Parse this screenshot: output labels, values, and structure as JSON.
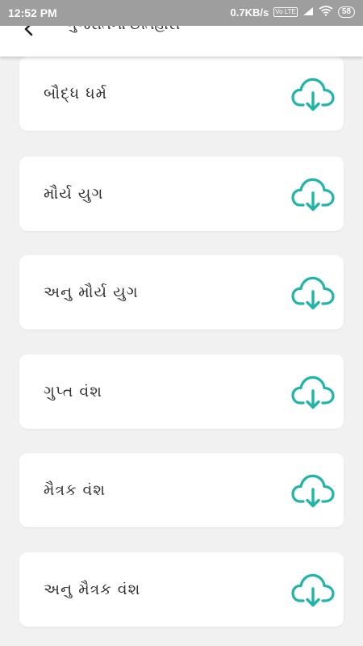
{
  "status_bar": {
    "time": "12:52 PM",
    "net_speed": "0.7KB/s",
    "volte": "Vo LTE",
    "battery": "58"
  },
  "app_bar": {
    "title": "ગુજરાતનો ઈતિહાસ",
    "back_icon": "back-chevron-icon"
  },
  "accent_color": "#1fb5a7",
  "items": [
    {
      "label": "બૌદ્ધ ધર્મ",
      "icon": "cloud-download-icon"
    },
    {
      "label": "મૌર્ય યુગ",
      "icon": "cloud-download-icon"
    },
    {
      "label": "અનુ મૌર્ય યુગ",
      "icon": "cloud-download-icon"
    },
    {
      "label": "ગુપ્ત વંશ",
      "icon": "cloud-download-icon"
    },
    {
      "label": "મૈત્રક વંશ",
      "icon": "cloud-download-icon"
    },
    {
      "label": "અનુ મૈત્રક વંશ",
      "icon": "cloud-download-icon"
    }
  ]
}
